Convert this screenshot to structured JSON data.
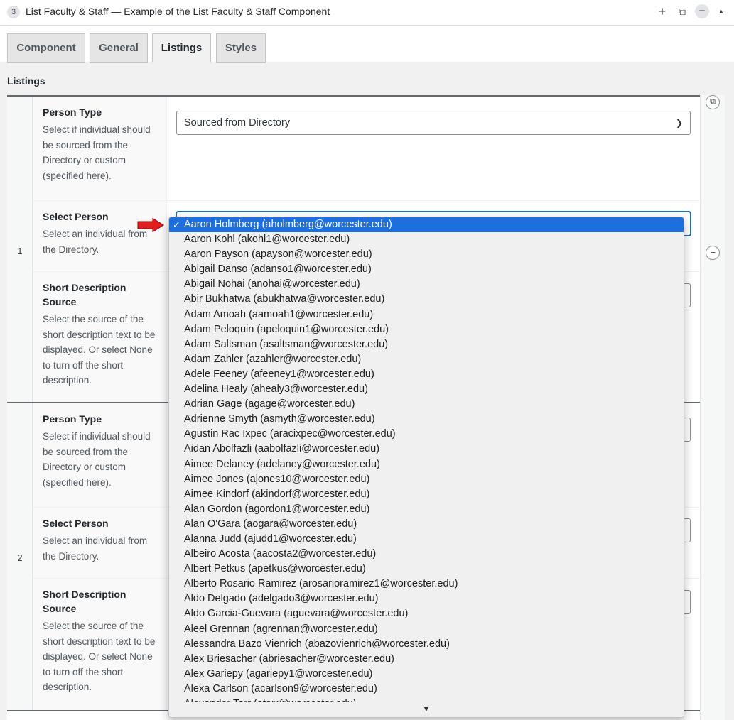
{
  "header": {
    "index": "3",
    "title": "List Faculty & Staff — Example of the List Faculty & Staff Component",
    "add_icon": "plus-icon",
    "duplicate_icon": "duplicate-icon",
    "remove_icon": "minus-circle-icon",
    "collapse_icon": "caret-up-icon"
  },
  "tabs": [
    {
      "label": "Component"
    },
    {
      "label": "General"
    },
    {
      "label": "Listings"
    },
    {
      "label": "Styles"
    }
  ],
  "active_tab": "Listings",
  "section_label": "Listings",
  "rows": [
    {
      "index": "1",
      "fields": [
        {
          "label": "Person Type",
          "instructions": "Select if individual should be sourced from the Directory or custom (specified here).",
          "value": "Sourced from Directory"
        },
        {
          "label": "Select Person",
          "instructions": "Select an individual from the Directory.",
          "value": "Aaron Holmberg (aholmberg@worcester.edu)"
        },
        {
          "label": "Short Description Source",
          "instructions": "Select the source of the short description text to be displayed. Or select None to turn off the short description.",
          "value": ""
        }
      ]
    },
    {
      "index": "2",
      "fields": [
        {
          "label": "Person Type",
          "instructions": "Select if individual should be sourced from the Directory or custom (specified here).",
          "value": ""
        },
        {
          "label": "Select Person",
          "instructions": "Select an individual from the Directory.",
          "value": ""
        },
        {
          "label": "Short Description Source",
          "instructions": "Select the source of the short description text to be displayed. Or select None to turn off the short description.",
          "value": ""
        }
      ]
    }
  ],
  "dropdown": {
    "selected_index": 0,
    "check_glyph": "✓",
    "scroll_glyph": "▼",
    "options": [
      "Aaron Holmberg (aholmberg@worcester.edu)",
      "Aaron Kohl (akohl1@worcester.edu)",
      "Aaron Payson (apayson@worcester.edu)",
      "Abigail Danso (adanso1@worcester.edu)",
      "Abigail Nohai (anohai@worcester.edu)",
      "Abir Bukhatwa (abukhatwa@worcester.edu)",
      "Adam Amoah (aamoah1@worcester.edu)",
      "Adam Peloquin (apeloquin1@worcester.edu)",
      "Adam Saltsman (asaltsman@worcester.edu)",
      "Adam Zahler (azahler@worcester.edu)",
      "Adele Feeney (afeeney1@worcester.edu)",
      "Adelina Healy (ahealy3@worcester.edu)",
      "Adrian Gage (agage@worcester.edu)",
      "Adrienne Smyth (asmyth@worcester.edu)",
      "Agustin Rac Ixpec (aracixpec@worcester.edu)",
      "Aidan Abolfazli (aabolfazli@worcester.edu)",
      "Aimee Delaney (adelaney@worcester.edu)",
      "Aimee Jones (ajones10@worcester.edu)",
      "Aimee Kindorf (akindorf@worcester.edu)",
      "Alan Gordon (agordon1@worcester.edu)",
      "Alan O'Gara (aogara@worcester.edu)",
      "Alanna Judd (ajudd1@worcester.edu)",
      "Albeiro Acosta (aacosta2@worcester.edu)",
      "Albert Petkus (apetkus@worcester.edu)",
      "Alberto Rosario Ramirez (arosarioramirez1@worcester.edu)",
      "Aldo Delgado (adelgado3@worcester.edu)",
      "Aldo Garcia-Guevara (aguevara@worcester.edu)",
      "Aleel Grennan (agrennan@worcester.edu)",
      "Alessandra Bazo Vienrich (abazovienrich@worcester.edu)",
      "Alex Briesacher (abriesacher@worcester.edu)",
      "Alex Gariepy (agariepy1@worcester.edu)",
      "Alexa Carlson (acarlson9@worcester.edu)",
      "Alexander Tarr (atarr@worcester.edu)"
    ]
  },
  "colors": {
    "selection": "#1c6fdc",
    "arrow": "#e02020",
    "focus": "#2271b1"
  }
}
